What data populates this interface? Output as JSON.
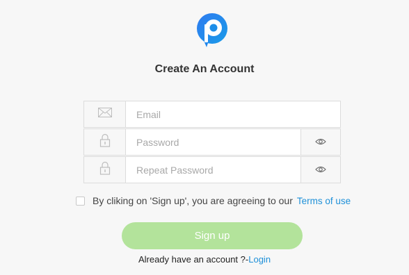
{
  "header": {
    "logo_icon": "p-chat-bubble-logo-icon",
    "title": "Create An Account"
  },
  "form": {
    "email": {
      "placeholder": "Email",
      "icon": "envelope-icon"
    },
    "password": {
      "placeholder": "Password",
      "icon": "lock-icon",
      "toggle_icon": "eye-icon"
    },
    "repeat_password": {
      "placeholder": "Repeat Password",
      "icon": "lock-icon",
      "toggle_icon": "eye-icon"
    },
    "agree_text": "By cliking on 'Sign up', you are agreeing to our",
    "terms_link": "Terms of use",
    "agree_checked": false
  },
  "actions": {
    "signup_label": "Sign up",
    "already_text": "Already have an account ?-",
    "login_link": "Login"
  },
  "colors": {
    "accent_blue": "#1e90d8",
    "signup_button": "#b3e39b",
    "background": "#f7f7f7"
  }
}
